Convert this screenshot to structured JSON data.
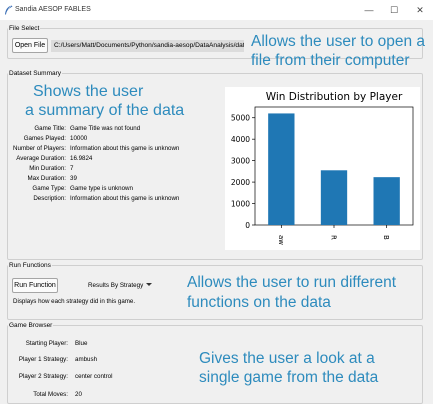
{
  "window": {
    "title": "Sandia AESOP FABLES",
    "minimize": "—",
    "maximize": "☐",
    "close": "✕"
  },
  "file_select": {
    "legend": "File Select",
    "open_button": "Open File",
    "path": "C:/Users/Matt/Documents/Python/sandia-aesop/DataAnalysis/dat"
  },
  "dataset_summary": {
    "legend": "Dataset Summary",
    "rows": [
      {
        "label": "Game Title:",
        "value": "Game Title was not found"
      },
      {
        "label": "Games Played:",
        "value": "10000"
      },
      {
        "label": "Number of Players:",
        "value": "Information about this game is unknown"
      },
      {
        "label": "Average Duration:",
        "value": "16.9824"
      },
      {
        "label": "Min Duration:",
        "value": "7"
      },
      {
        "label": "Max Duration:",
        "value": "39"
      },
      {
        "label": "Game Type:",
        "value": "Game type is unknown"
      },
      {
        "label": "Description:",
        "value": "Information about this game is unknown"
      }
    ]
  },
  "run_functions": {
    "legend": "Run Functions",
    "run_button": "Run Function",
    "selected_function": "Results By Strategy",
    "description": "Displays how each strategy did in this game."
  },
  "game_browser": {
    "legend": "Game Browser",
    "rows": [
      {
        "label": "Starting Player:",
        "value": "Blue"
      },
      {
        "label": "Player 1 Strategy:",
        "value": "ambush"
      },
      {
        "label": "Player 2 Strategy:",
        "value": "center control"
      },
      {
        "label": "Total Moves:",
        "value": "20"
      }
    ]
  },
  "annotations": {
    "file": [
      "Allows the user to open a",
      "file from their computer"
    ],
    "summary": [
      "Shows the user",
      "a summary of the data"
    ],
    "run": [
      "Allows the user to run different",
      "functions on the data"
    ],
    "browser": [
      "Gives the user a look at a",
      "single game from the data"
    ]
  },
  "colors": {
    "annotation": "#2d8bbd",
    "bar": "#1f77b4"
  },
  "chart_data": {
    "type": "bar",
    "title": "Win Distribution by Player",
    "xlabel": "",
    "ylabel": "",
    "categories": [
      "aw",
      "R",
      "B"
    ],
    "values": [
      5200,
      2550,
      2230
    ],
    "ylim": [
      0,
      5500
    ],
    "yticks": [
      0,
      1000,
      2000,
      3000,
      4000,
      5000
    ],
    "grid": false
  }
}
